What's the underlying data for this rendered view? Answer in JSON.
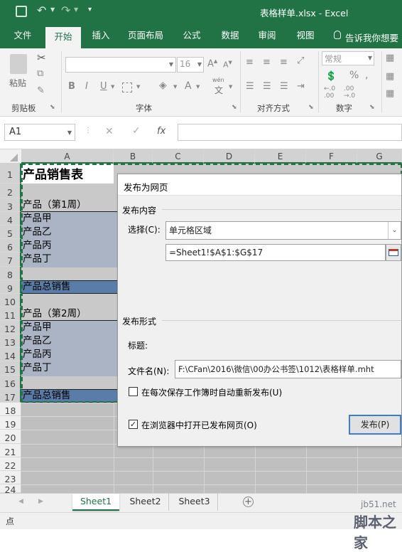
{
  "window": {
    "title": "表格样单.xlsx - Excel"
  },
  "ribbon_tabs": [
    "文件",
    "开始",
    "插入",
    "页面布局",
    "公式",
    "数据",
    "审阅",
    "视图"
  ],
  "tell_me": "告诉我你想要",
  "ribbon": {
    "paste": "粘贴",
    "clipboard": "剪贴板",
    "font_size": "16",
    "font_group": "字体",
    "align_group": "对齐方式",
    "number_format": "常规",
    "number_group": "数字",
    "bold": "B",
    "italic": "I",
    "underline": "U",
    "wen": "wén",
    "wen_char": "文"
  },
  "formula_bar": {
    "name_box": "A1",
    "fx": "fx"
  },
  "columns": [
    "A",
    "B",
    "C",
    "D",
    "E",
    "F",
    "G"
  ],
  "rows": [
    "1",
    "2",
    "3",
    "4",
    "5",
    "6",
    "7",
    "8",
    "9",
    "10",
    "11",
    "12",
    "13",
    "14",
    "15",
    "16",
    "17",
    "18",
    "19",
    "20",
    "21",
    "22",
    "23",
    "24"
  ],
  "cells": {
    "a1": "产品销售表",
    "a3": "产品（第1周）",
    "a4": "产品甲",
    "a5": "产品乙",
    "a6": "产品丙",
    "a7": "产品丁",
    "a9": "产品总销售",
    "a11": "产品（第2周）",
    "a12": "产品甲",
    "a13": "产品乙",
    "a14": "产品丙",
    "a15": "产品丁",
    "a17": "产品总销售"
  },
  "dialog": {
    "title": "发布为网页",
    "content_section": "发布内容",
    "select_label": "选择(C):",
    "select_value": "单元格区域",
    "range_value": "=Sheet1!$A$1:$G$17",
    "format_section": "发布形式",
    "title_label": "标题:",
    "filename_label": "文件名(N):",
    "filename_value": "F:\\CFan\\2016\\微信\\00办公书签\\1012\\表格样单.mht",
    "auto_republish": "在每次保存工作簿时自动重新发布(U)",
    "open_in_browser": "在浏览器中打开已发布网页(O)",
    "publish_button": "发布(P)"
  },
  "sheets": [
    "Sheet1",
    "Sheet2",
    "Sheet3"
  ],
  "status": {
    "mode": "点"
  },
  "watermark": {
    "site": "jb51.net",
    "name": "脚本之家"
  }
}
